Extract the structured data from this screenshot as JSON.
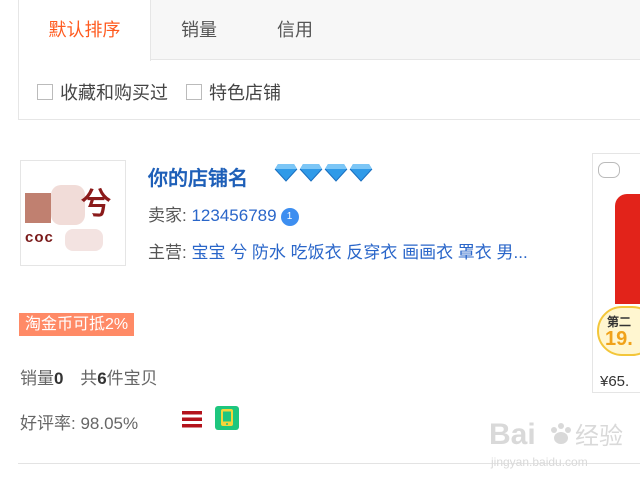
{
  "tabs": [
    {
      "label": "默认排序",
      "active": true
    },
    {
      "label": "销量",
      "active": false
    },
    {
      "label": "信用",
      "active": false
    }
  ],
  "filters": [
    {
      "label": "收藏和购买过",
      "checked": false
    },
    {
      "label": "特色店铺",
      "checked": false
    }
  ],
  "shop": {
    "name": "你的店铺名",
    "seller_label": "卖家:",
    "seller_id": "123456789",
    "main_label": "主营:",
    "main_items": "宝宝 兮 防水 吃饭衣 反穿衣 画画衣 罩衣 男...",
    "logo_text_top": "兮",
    "logo_text_bottom": "coc",
    "coin_tag": "淘金币可抵2%",
    "sales_label": "销量",
    "sales_value": "0",
    "items_prefix": "共",
    "items_value": "6",
    "items_suffix": "件宝贝",
    "rating_label": "好评率:",
    "rating_value": "98.05%"
  },
  "product_preview": {
    "promo_text": "第二",
    "promo_price": "19.",
    "price": "¥65."
  },
  "watermark": {
    "brand": "Bai",
    "brand_cn": "经验",
    "url": "jingyan.baidu.com"
  },
  "colors": {
    "accent": "#ff5a1f",
    "link": "#1e5fb8",
    "coin_tag_bg": "#ff8a66",
    "diamond": "#2f9ae8"
  }
}
